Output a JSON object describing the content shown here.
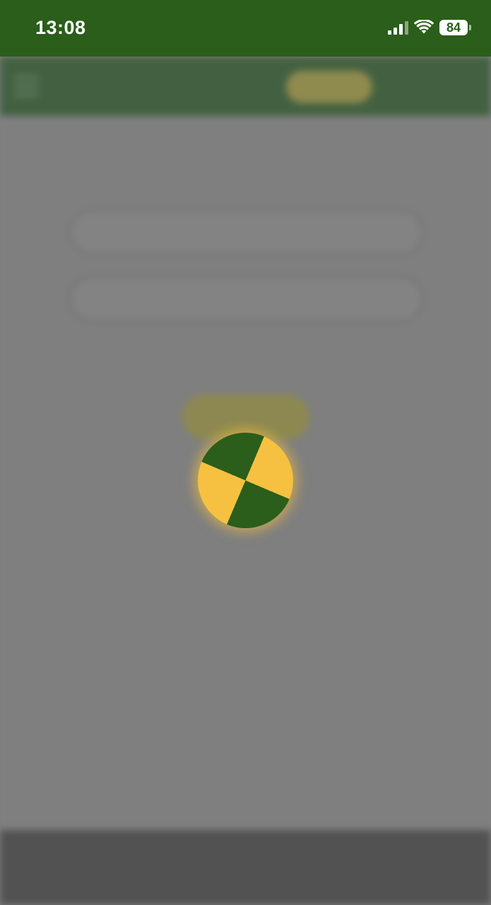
{
  "status_bar": {
    "time": "13:08",
    "battery": "84",
    "icons": [
      "cellular-signal-icon",
      "wifi-icon",
      "battery-icon"
    ]
  },
  "colors": {
    "brand_green": "#2a5e1a",
    "brand_yellow": "#f6c140",
    "overlay_gray": "#808080"
  },
  "header": {
    "icons": [
      "hamburger-menu-icon"
    ]
  },
  "loading_spinner": {
    "icon": "loading-spinner-icon",
    "colors": [
      "#2a5e1a",
      "#f6c140"
    ]
  },
  "floating_action_button": {
    "icon": "chat-bubble-icon"
  }
}
